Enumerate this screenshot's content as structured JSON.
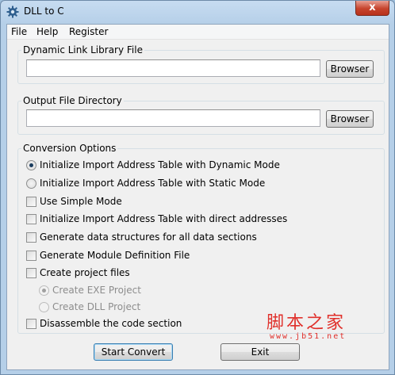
{
  "window": {
    "title": "DLL to C",
    "close_label": "x"
  },
  "menu": [
    "File",
    "Help",
    "Register"
  ],
  "dll_group": {
    "label": "Dynamic Link Library File",
    "value": "",
    "browse_label": "Browser"
  },
  "output_group": {
    "label": "Output File Directory",
    "value": "",
    "browse_label": "Browser"
  },
  "options_group": {
    "label": "Conversion Options",
    "items": [
      {
        "type": "radio",
        "label": "Initialize Import Address Table with Dynamic Mode",
        "checked": true,
        "enabled": true
      },
      {
        "type": "radio",
        "label": "Initialize Import Address Table with Static Mode",
        "checked": false,
        "enabled": true
      },
      {
        "type": "checkbox",
        "label": "Use Simple Mode",
        "checked": false,
        "enabled": true
      },
      {
        "type": "checkbox",
        "label": "Initialize Import Address Table with direct addresses",
        "checked": false,
        "enabled": true
      },
      {
        "type": "checkbox",
        "label": "Generate data structures for all data sections",
        "checked": false,
        "enabled": true
      },
      {
        "type": "checkbox",
        "label": "Generate Module Definition File",
        "checked": false,
        "enabled": true
      },
      {
        "type": "checkbox",
        "label": "Create project files",
        "checked": false,
        "enabled": true
      },
      {
        "type": "radio",
        "label": "Create EXE Project",
        "checked": true,
        "enabled": false
      },
      {
        "type": "radio",
        "label": "Create DLL Project",
        "checked": false,
        "enabled": false
      },
      {
        "type": "checkbox",
        "label": "Disassemble the code section",
        "checked": false,
        "enabled": true
      }
    ]
  },
  "buttons": {
    "start": "Start Convert",
    "exit": "Exit"
  },
  "watermark": {
    "main": "脚本之家",
    "sub": "www.jb51.net"
  },
  "colors": {
    "close_button": "#c6432c",
    "watermark": "#e0302b",
    "title_bar": "#b5cfe8"
  }
}
